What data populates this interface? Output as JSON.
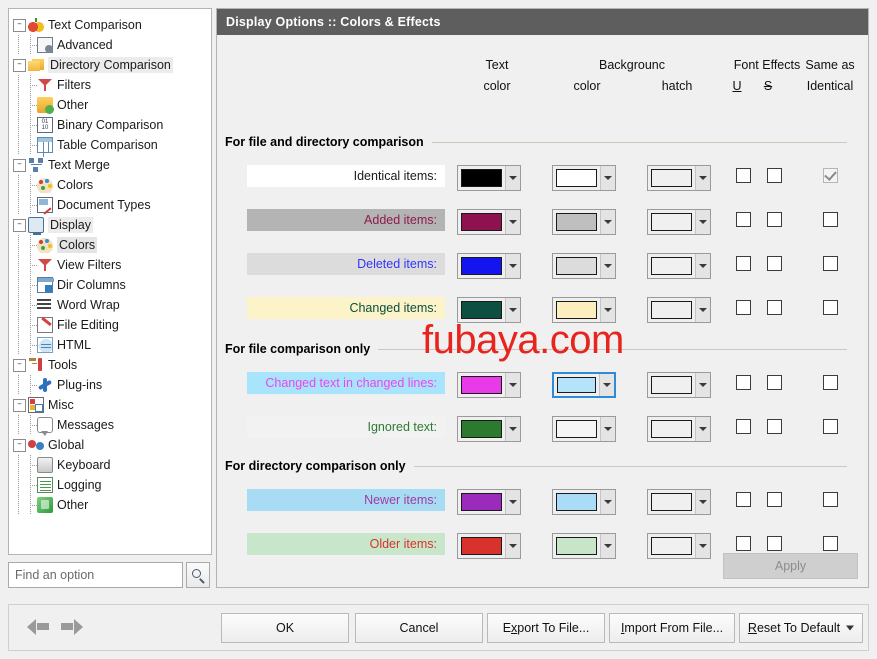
{
  "sidebar": {
    "search": {
      "placeholder": "Find an option",
      "value": ""
    },
    "items": [
      {
        "label": "Text Comparison",
        "icon": "apple-icon",
        "depth": 0,
        "expander": "minus",
        "state": "normal"
      },
      {
        "label": "Advanced",
        "icon": "advanced-doc-icon",
        "depth": 1,
        "expander": "none",
        "state": "normal"
      },
      {
        "label": "Directory Comparison",
        "icon": "folders-icon",
        "depth": 0,
        "expander": "minus",
        "state": "hl"
      },
      {
        "label": "Filters",
        "icon": "filter-icon",
        "depth": 1,
        "expander": "none",
        "state": "normal"
      },
      {
        "label": "Other",
        "icon": "folder-check-icon",
        "depth": 1,
        "expander": "none",
        "state": "normal"
      },
      {
        "label": "Binary Comparison",
        "icon": "binary-icon",
        "depth": 1,
        "expander": "none",
        "state": "normal"
      },
      {
        "label": "Table Comparison",
        "icon": "table-icon",
        "depth": 1,
        "expander": "none",
        "state": "normal"
      },
      {
        "label": "Text Merge",
        "icon": "merge-icon",
        "depth": 0,
        "expander": "minus",
        "state": "normal"
      },
      {
        "label": "Colors",
        "icon": "palette-icon",
        "depth": 1,
        "expander": "none",
        "state": "normal"
      },
      {
        "label": "Document Types",
        "icon": "doc-types-icon",
        "depth": 1,
        "expander": "none",
        "state": "normal"
      },
      {
        "label": "Display",
        "icon": "monitor-icon",
        "depth": 0,
        "expander": "minus",
        "state": "hl"
      },
      {
        "label": "Colors",
        "icon": "palette-icon",
        "depth": 1,
        "expander": "none",
        "state": "selected"
      },
      {
        "label": "View Filters",
        "icon": "filter-icon",
        "depth": 1,
        "expander": "none",
        "state": "normal"
      },
      {
        "label": "Dir Columns",
        "icon": "dir-columns-icon",
        "depth": 1,
        "expander": "none",
        "state": "normal"
      },
      {
        "label": "Word Wrap",
        "icon": "word-wrap-icon",
        "depth": 1,
        "expander": "none",
        "state": "normal"
      },
      {
        "label": "File Editing",
        "icon": "file-editing-icon",
        "depth": 1,
        "expander": "none",
        "state": "normal"
      },
      {
        "label": "HTML",
        "icon": "html-icon",
        "depth": 1,
        "expander": "none",
        "state": "normal"
      },
      {
        "label": "Tools",
        "icon": "tools-icon",
        "depth": 0,
        "expander": "minus",
        "state": "normal"
      },
      {
        "label": "Plug-ins",
        "icon": "plugin-icon",
        "depth": 1,
        "expander": "none",
        "state": "normal"
      },
      {
        "label": "Misc",
        "icon": "misc-icon",
        "depth": 0,
        "expander": "minus",
        "state": "normal"
      },
      {
        "label": "Messages",
        "icon": "message-icon",
        "depth": 1,
        "expander": "none",
        "state": "normal"
      },
      {
        "label": "Global",
        "icon": "global-icon",
        "depth": 0,
        "expander": "minus",
        "state": "normal"
      },
      {
        "label": "Keyboard",
        "icon": "keyboard-icon",
        "depth": 1,
        "expander": "none",
        "state": "normal"
      },
      {
        "label": "Logging",
        "icon": "logging-icon",
        "depth": 1,
        "expander": "none",
        "state": "normal"
      },
      {
        "label": "Other",
        "icon": "other-icon",
        "depth": 1,
        "expander": "none",
        "state": "normal"
      }
    ]
  },
  "panel": {
    "title": "Display Options :: Colors & Effects",
    "watermark": "fubaya.com",
    "apply_label": "Apply",
    "columns": {
      "text_top": "Text",
      "text_bottom": "color",
      "background_top": "Backgrounc",
      "background_color": "color",
      "background_hatch": "hatch",
      "font_effects": "Font Effects",
      "effect_underline": "U",
      "effect_strikeout": "S",
      "same_as_top": "Same as",
      "same_as_bottom": "Identical"
    },
    "sections": [
      {
        "title": "For file and directory comparison",
        "rows": [
          {
            "label": "Identical items:",
            "preview_bg": "#ffffff",
            "preview_fg": "#1a1a1a",
            "text_color": "#000000",
            "bg_color": "#ffffff",
            "hatch_color": "#f0f0f0",
            "underline": false,
            "strikeout": false,
            "same_as_identical": true,
            "same_as_disabled": true,
            "bg_focus": false
          },
          {
            "label": "Added items:",
            "preview_bg": "#b4b4b4",
            "preview_fg": "#8e1a4e",
            "text_color": "#8e1150",
            "bg_color": "#bfbfbf",
            "hatch_color": "#f0f0f0",
            "underline": false,
            "strikeout": false,
            "same_as_identical": false,
            "same_as_disabled": false,
            "bg_focus": false
          },
          {
            "label": "Deleted items:",
            "preview_bg": "#dcdcdc",
            "preview_fg": "#3333ff",
            "text_color": "#1414f0",
            "bg_color": "#dcdcdc",
            "hatch_color": "#f0f0f0",
            "underline": false,
            "strikeout": false,
            "same_as_identical": false,
            "same_as_disabled": false,
            "bg_focus": false
          },
          {
            "label": "Changed items:",
            "preview_bg": "#fcf3c8",
            "preview_fg": "#0b4d3f",
            "text_color": "#0d4f41",
            "bg_color": "#fdeec0",
            "hatch_color": "#f0f0f0",
            "underline": false,
            "strikeout": false,
            "same_as_identical": false,
            "same_as_disabled": false,
            "bg_focus": false
          }
        ]
      },
      {
        "title": "For file comparison only",
        "rows": [
          {
            "label": "Changed text in changed lines:",
            "preview_bg": "#a8e4fb",
            "preview_fg": "#ee44ee",
            "text_color": "#e83ae8",
            "bg_color": "#b5e4fa",
            "hatch_color": "#f0f0f0",
            "underline": false,
            "strikeout": false,
            "same_as_identical": false,
            "same_as_disabled": false,
            "bg_focus": true
          },
          {
            "label": "Ignored text:",
            "preview_bg": "#f2f2f2",
            "preview_fg": "#2d7a33",
            "text_color": "#2b7a2f",
            "bg_color": "#f5f5f5",
            "hatch_color": "#f0f0f0",
            "underline": false,
            "strikeout": false,
            "same_as_identical": false,
            "same_as_disabled": false,
            "bg_focus": false
          }
        ]
      },
      {
        "title": "For directory comparison only",
        "rows": [
          {
            "label": "Newer items:",
            "preview_bg": "#a8dcf5",
            "preview_fg": "#a03ca0",
            "text_color": "#9c2bbd",
            "bg_color": "#aadcf7",
            "hatch_color": "#f0f0f0",
            "underline": false,
            "strikeout": false,
            "same_as_identical": false,
            "same_as_disabled": false,
            "bg_focus": false
          },
          {
            "label": "Older items:",
            "preview_bg": "#c8e6c9",
            "preview_fg": "#d8332d",
            "text_color": "#d8322c",
            "bg_color": "#c7e5c8",
            "hatch_color": "#f0f0f0",
            "underline": false,
            "strikeout": false,
            "same_as_identical": false,
            "same_as_disabled": false,
            "bg_focus": false
          }
        ]
      }
    ]
  },
  "footer": {
    "buttons": [
      {
        "label": "OK",
        "accel": "",
        "name": "ok-button",
        "split": false
      },
      {
        "label": "Cancel",
        "accel": "",
        "name": "cancel-button",
        "split": false
      },
      {
        "label": "Export To File...",
        "accel": "x",
        "name": "export-to-file-button",
        "split": false
      },
      {
        "label": "Import From File...",
        "accel": "I",
        "name": "import-from-file-button",
        "split": false
      },
      {
        "label": "Reset To Default",
        "accel": "R",
        "name": "reset-to-default-button",
        "split": true
      }
    ],
    "nav_back": "back-arrow",
    "nav_forward": "forward-arrow"
  },
  "theme": {
    "title_bar_bg": "#5e5e5e",
    "dialog_bg": "#f0f0f0",
    "focus_border": "#2f8ad8",
    "watermark_color": "#e8241e"
  }
}
